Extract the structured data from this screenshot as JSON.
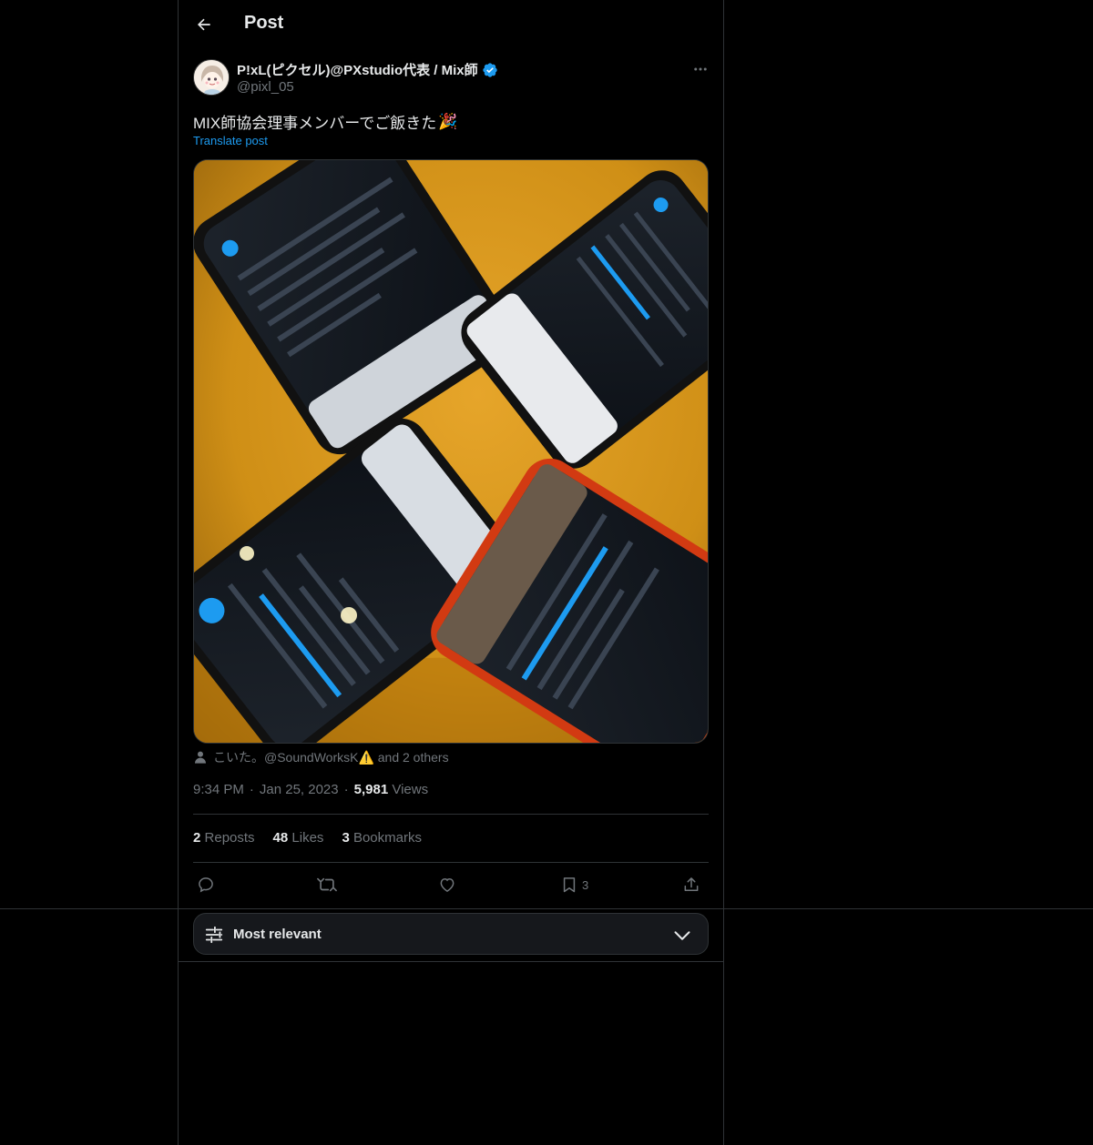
{
  "header": {
    "title": "Post",
    "back_icon": "arrow-left-icon"
  },
  "post": {
    "author_name": "P!xL(ピクセル)@PXstudio代表 / Mix師",
    "handle": "@pixl_05",
    "verified_color": "#1d9bf0",
    "text": "MIX師協会理事メンバーでご飯きた",
    "emoji": "🎉",
    "translate_label": "Translate post",
    "tagged": "こいた。@SoundWorksK⚠️ and 2 others",
    "time": "9:34 PM",
    "date": "Jan 25, 2023",
    "views_count": "5,981",
    "views_label": "Views"
  },
  "stats": {
    "reposts_count": "2",
    "reposts_label": "Reposts",
    "likes_count": "48",
    "likes_label": "Likes",
    "bookmarks_count": "3",
    "bookmarks_label": "Bookmarks"
  },
  "actions": {
    "bookmark_count": "3"
  },
  "sort": {
    "label": "Most relevant"
  },
  "colors": {
    "background": "#000000",
    "text": "#e7e9ea",
    "muted": "#71767b",
    "accent": "#1d9bf0",
    "border": "#2f3336"
  }
}
